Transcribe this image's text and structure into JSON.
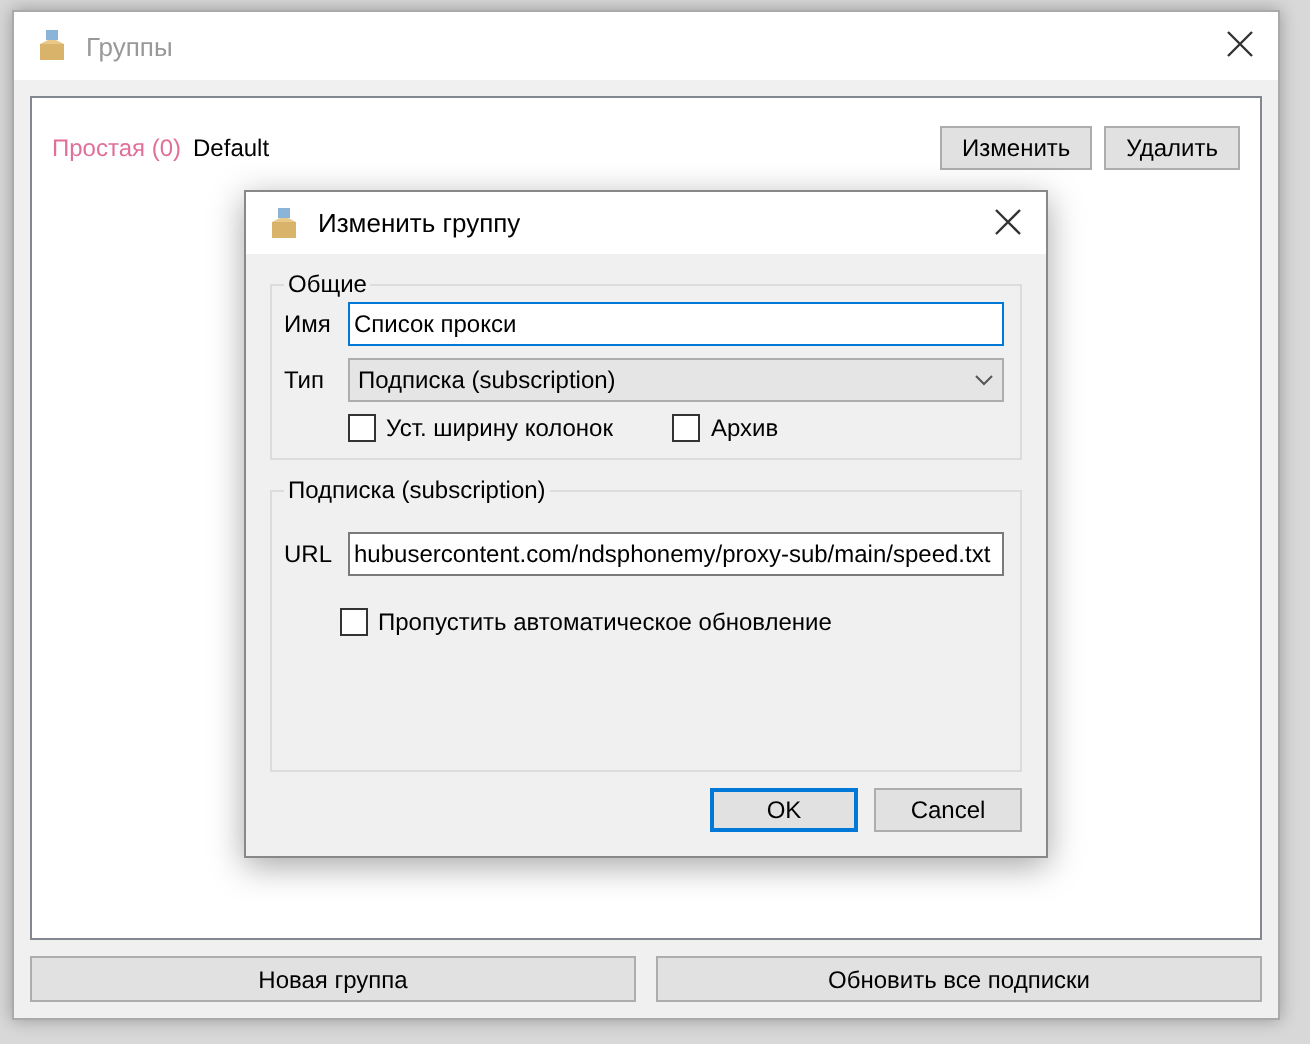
{
  "window": {
    "title": "Группы"
  },
  "groups": [
    {
      "type": "Простая (0)",
      "name": "Default",
      "buttons": [
        "Изменить",
        "Удалить"
      ]
    }
  ],
  "footer_buttons": [
    "Новая группа",
    "Обновить все подписки"
  ],
  "dialog": {
    "title": "Изменить группу",
    "general": {
      "legend": "Общие",
      "name_label": "Имя",
      "name_value": "Список прокси",
      "type_label": "Тип",
      "type_value": "Подписка (subscription)",
      "checkboxes": [
        {
          "label": "Уст. ширину колонок",
          "checked": false
        },
        {
          "label": "Архив",
          "checked": false
        }
      ]
    },
    "subscription": {
      "legend": "Подписка (subscription)",
      "url_label": "URL",
      "url_value": "hubusercontent.com/ndsphonemy/proxy-sub/main/speed.txt",
      "checkboxes": [
        {
          "label": "Пропустить автоматическое обновление",
          "checked": false
        }
      ]
    },
    "buttons": [
      {
        "label": "OK",
        "selected": true
      },
      {
        "label": "Cancel",
        "selected": false
      }
    ]
  }
}
